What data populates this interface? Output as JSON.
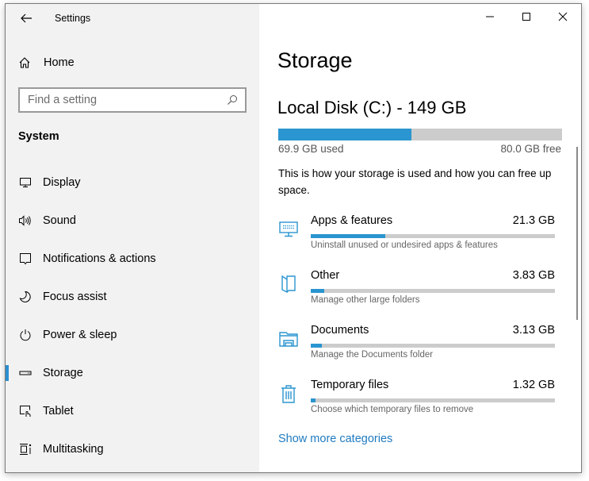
{
  "window": {
    "title": "Settings",
    "controls": {
      "minimize": "minimize",
      "maximize": "maximize",
      "close": "close"
    }
  },
  "sidebar": {
    "home_label": "Home",
    "search_placeholder": "Find a setting",
    "section_title": "System",
    "items": [
      {
        "label": "Display",
        "icon": "monitor-icon",
        "selected": false
      },
      {
        "label": "Sound",
        "icon": "speaker-icon",
        "selected": false
      },
      {
        "label": "Notifications & actions",
        "icon": "notification-icon",
        "selected": false
      },
      {
        "label": "Focus assist",
        "icon": "moon-icon",
        "selected": false
      },
      {
        "label": "Power & sleep",
        "icon": "power-icon",
        "selected": false
      },
      {
        "label": "Storage",
        "icon": "storage-drive-icon",
        "selected": true
      },
      {
        "label": "Tablet",
        "icon": "tablet-icon",
        "selected": false
      },
      {
        "label": "Multitasking",
        "icon": "multitasking-icon",
        "selected": false
      }
    ]
  },
  "main": {
    "page_title": "Storage",
    "disk": {
      "title": "Local Disk (C:) - 149 GB",
      "used_label": "69.9 GB used",
      "free_label": "80.0 GB free",
      "used_fraction": 0.469
    },
    "description": "This is how your storage is used and how you can free up space.",
    "categories": [
      {
        "name": "Apps & features",
        "size": "21.3 GB",
        "subtitle": "Uninstall unused or undesired apps & features",
        "icon": "apps-icon",
        "fraction": 0.305
      },
      {
        "name": "Other",
        "size": "3.83 GB",
        "subtitle": "Manage other large folders",
        "icon": "folder-other-icon",
        "fraction": 0.055
      },
      {
        "name": "Documents",
        "size": "3.13 GB",
        "subtitle": "Manage the Documents folder",
        "icon": "documents-folder-icon",
        "fraction": 0.045
      },
      {
        "name": "Temporary files",
        "size": "1.32 GB",
        "subtitle": "Choose which temporary files to remove",
        "icon": "trash-icon",
        "fraction": 0.019
      }
    ],
    "show_more_label": "Show more categories"
  },
  "colors": {
    "accent": "#2a95d0",
    "link": "#1f7bc1",
    "bar_track": "#cccccc",
    "sidebar_bg": "#f2f2f2"
  }
}
